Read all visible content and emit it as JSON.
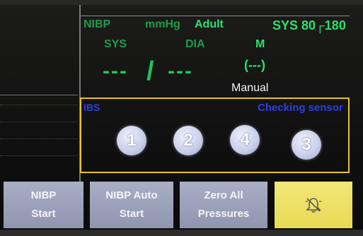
{
  "nibp": {
    "title": "NIBP",
    "unit": "mmHg",
    "patient_type": "Adult",
    "sys_alarm_limits": "SYS 80┌180",
    "sys_label": "SYS",
    "dia_label": "DIA",
    "mean_label": "M",
    "sys_value": "---",
    "slash": "/",
    "dia_value": "---",
    "mean_value": "(---)",
    "mode": "Manual"
  },
  "ibp": {
    "title": "IBS",
    "status": "Checking sensor",
    "sensors": [
      "1",
      "2",
      "4",
      "3"
    ]
  },
  "buttons": {
    "nibp_start": [
      "NIBP",
      "Start"
    ],
    "nibp_auto_start": [
      "NIBP Auto",
      "Start"
    ],
    "zero_all": [
      "Zero All",
      "Pressures"
    ],
    "alarm_silence_icon": "alarm-off-bell-icon"
  },
  "colors": {
    "numeric_green": "#2fe06a",
    "status_blue": "#2c3fe0",
    "ibp_frame_yellow": "#e8c22a",
    "button_gray": "#9fa4bf",
    "button_yellow": "#ece064"
  }
}
